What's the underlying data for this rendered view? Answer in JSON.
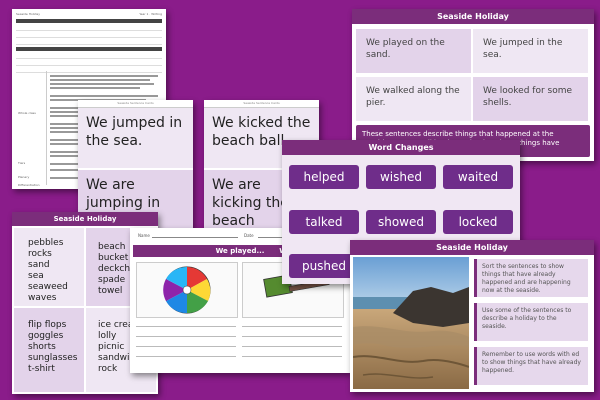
{
  "plan": {
    "title": "Seaside Holiday",
    "subject": "Year 1 · Writing",
    "side_labels": [
      "Whole class",
      "Tiers",
      "Plenary",
      "Differentiation"
    ]
  },
  "cards1": {
    "top": "Seaside Sentence Cards",
    "s1": "We jumped in the sea.",
    "s2": "We are jumping in the"
  },
  "cards2": {
    "top": "Seaside Sentence Cards",
    "s1": "We kicked the beach ball.",
    "s2": "We are kicking the beach"
  },
  "sea1": {
    "header": "Seaside Holiday",
    "sentences": [
      "We played on the sand.",
      "We jumped in the sea.",
      "We walked along the pier.",
      "We looked for some shells."
    ],
    "note": "These sentences describe things that happened at the seaside. We can tell by the verbs that these things have already happened."
  },
  "word_changes": {
    "header": "Word Changes",
    "words": [
      "helped",
      "wished",
      "waited",
      "talked",
      "showed",
      "locked",
      "pushed"
    ]
  },
  "word_list": {
    "header": "Seaside Holiday",
    "col1a": [
      "pebbles",
      "rocks",
      "sand",
      "sea",
      "seaweed",
      "waves"
    ],
    "col2a": [
      "beach",
      "bucket",
      "deckchair",
      "spade",
      "towel"
    ],
    "col1b": [
      "flip flops",
      "goggles",
      "shorts",
      "sunglasses",
      "t-shirt"
    ],
    "col2b": [
      "ice cream",
      "lolly",
      "picnic",
      "sandwich",
      "rock"
    ]
  },
  "played": {
    "name_label": "Name",
    "date_label": "Date",
    "header": "We played...",
    "header_right": "W"
  },
  "sea2": {
    "header": "Seaside Holiday",
    "tips": [
      "Sort the sentences to show things that have already happened and are happening now at the seaside.",
      "Use some of the sentences to describe a holiday to the seaside.",
      "Remember to use words with ed to show things that have already happened."
    ]
  }
}
